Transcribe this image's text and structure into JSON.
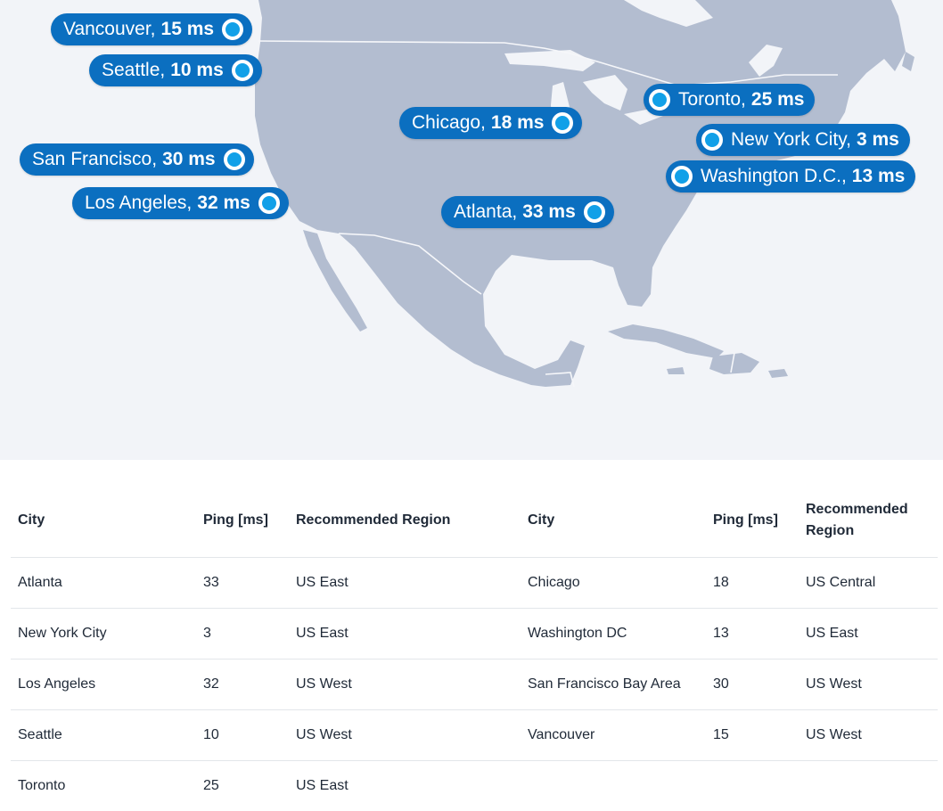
{
  "map": {
    "markers": [
      {
        "city": "Vancouver,",
        "ping": "15 ms"
      },
      {
        "city": "Seattle,",
        "ping": "10 ms"
      },
      {
        "city": "San Francisco,",
        "ping": "30 ms"
      },
      {
        "city": "Los Angeles,",
        "ping": "32 ms"
      },
      {
        "city": "Chicago,",
        "ping": "18 ms"
      },
      {
        "city": "Atlanta,",
        "ping": "33 ms"
      },
      {
        "city": "Toronto,",
        "ping": "25 ms"
      },
      {
        "city": "New York City,",
        "ping": "3 ms"
      },
      {
        "city": "Washington D.C.,",
        "ping": "13 ms"
      }
    ],
    "colors": {
      "land": "#b3bdd0",
      "background": "#f2f4f8",
      "pin": "#0b6fc0",
      "dot": "#11a0e8"
    }
  },
  "table": {
    "headers": [
      "City",
      "Ping [ms]",
      "Recommended Region",
      "City",
      "Ping [ms]",
      "Recommended Region"
    ],
    "rows": [
      [
        "Atlanta",
        "33",
        "US East",
        "Chicago",
        "18",
        "US Central"
      ],
      [
        "New York City",
        "3",
        "US East",
        "Washington DC",
        "13",
        "US East"
      ],
      [
        "Los Angeles",
        "32",
        "US West",
        "San Francisco Bay Area",
        "30",
        "US West"
      ],
      [
        "Seattle",
        "10",
        "US West",
        "Vancouver",
        "15",
        "US West"
      ],
      [
        "Toronto",
        "25",
        "US East",
        "",
        "",
        ""
      ]
    ]
  }
}
